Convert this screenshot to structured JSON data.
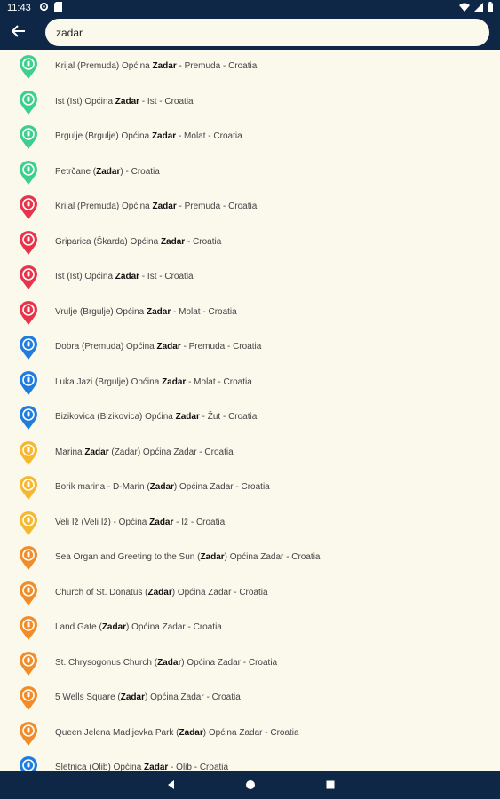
{
  "status_bar": {
    "time": "11:43"
  },
  "search": {
    "value": "zadar"
  },
  "colors": {
    "bar_bg": "#0e2747",
    "page_bg": "#fbf8ec",
    "green": "#3ecf8e",
    "red": "#e8344a",
    "blue": "#1f7de0",
    "yellow": "#f5b82e",
    "orange": "#f28c28"
  },
  "results": [
    {
      "icon": "green-location-pin-icon",
      "color": "green",
      "parts": [
        [
          "Krijal (Premuda) Općina ",
          0
        ],
        [
          "Zadar",
          1
        ],
        [
          " - Premuda - Croatia",
          0
        ]
      ]
    },
    {
      "icon": "green-location-pin-icon",
      "color": "green",
      "parts": [
        [
          "Ist (Ist) Općina ",
          0
        ],
        [
          "Zadar",
          1
        ],
        [
          " - Ist - Croatia",
          0
        ]
      ]
    },
    {
      "icon": "green-location-pin-icon",
      "color": "green",
      "parts": [
        [
          "Brgulje (Brgulje) Općina ",
          0
        ],
        [
          "Zadar",
          1
        ],
        [
          " - Molat - Croatia",
          0
        ]
      ]
    },
    {
      "icon": "green-location-pin-icon",
      "color": "green",
      "parts": [
        [
          "Petrčane (",
          0
        ],
        [
          "Zadar",
          1
        ],
        [
          ") - Croatia",
          0
        ]
      ]
    },
    {
      "icon": "red-location-pin-icon",
      "color": "red",
      "parts": [
        [
          "Krijal (Premuda) Općina ",
          0
        ],
        [
          "Zadar",
          1
        ],
        [
          " - Premuda - Croatia",
          0
        ]
      ]
    },
    {
      "icon": "red-location-pin-icon",
      "color": "red",
      "parts": [
        [
          "Griparica (Škarda) Općina ",
          0
        ],
        [
          "Zadar",
          1
        ],
        [
          " - Croatia",
          0
        ]
      ]
    },
    {
      "icon": "red-location-pin-icon",
      "color": "red",
      "parts": [
        [
          "Ist (Ist) Općina ",
          0
        ],
        [
          "Zadar",
          1
        ],
        [
          " - Ist - Croatia",
          0
        ]
      ]
    },
    {
      "icon": "red-location-pin-icon",
      "color": "red",
      "parts": [
        [
          "Vrulje (Brgulje) Općina ",
          0
        ],
        [
          "Zadar",
          1
        ],
        [
          " - Molat - Croatia",
          0
        ]
      ]
    },
    {
      "icon": "blue-location-pin-icon",
      "color": "blue",
      "parts": [
        [
          "Dobra (Premuda) Općina ",
          0
        ],
        [
          "Zadar",
          1
        ],
        [
          " - Premuda - Croatia",
          0
        ]
      ]
    },
    {
      "icon": "blue-location-pin-icon",
      "color": "blue",
      "parts": [
        [
          "Luka Jazi (Brgulje) Općina ",
          0
        ],
        [
          "Zadar",
          1
        ],
        [
          " - Molat - Croatia",
          0
        ]
      ]
    },
    {
      "icon": "blue-location-pin-icon",
      "color": "blue",
      "parts": [
        [
          "Bizikovica (Bizikovica) Općina ",
          0
        ],
        [
          "Zadar",
          1
        ],
        [
          " - Žut - Croatia",
          0
        ]
      ]
    },
    {
      "icon": "yellow-location-pin-icon",
      "color": "yellow",
      "parts": [
        [
          "Marina ",
          0
        ],
        [
          "Zadar",
          1
        ],
        [
          " (Zadar) Općina Zadar - Croatia",
          0
        ]
      ]
    },
    {
      "icon": "yellow-location-pin-icon",
      "color": "yellow",
      "parts": [
        [
          "Borik marina - D-Marin (",
          0
        ],
        [
          "Zadar",
          1
        ],
        [
          ") Općina Zadar - Croatia",
          0
        ]
      ]
    },
    {
      "icon": "yellow-location-pin-icon",
      "color": "yellow",
      "parts": [
        [
          "Veli Iž (Veli Iž) - Općina ",
          0
        ],
        [
          "Zadar",
          1
        ],
        [
          " - Iž - Croatia",
          0
        ]
      ]
    },
    {
      "icon": "orange-location-pin-icon",
      "color": "orange",
      "parts": [
        [
          "Sea Organ and Greeting to the Sun (",
          0
        ],
        [
          "Zadar",
          1
        ],
        [
          ") Općina Zadar - Croatia",
          0
        ]
      ]
    },
    {
      "icon": "orange-location-pin-icon",
      "color": "orange",
      "parts": [
        [
          "Church of St. Donatus (",
          0
        ],
        [
          "Zadar",
          1
        ],
        [
          ") Općina Zadar - Croatia",
          0
        ]
      ]
    },
    {
      "icon": "orange-location-pin-icon",
      "color": "orange",
      "parts": [
        [
          "Land Gate (",
          0
        ],
        [
          "Zadar",
          1
        ],
        [
          ") Općina Zadar - Croatia",
          0
        ]
      ]
    },
    {
      "icon": "orange-location-pin-icon",
      "color": "orange",
      "parts": [
        [
          "St. Chrysogonus Church (",
          0
        ],
        [
          "Zadar",
          1
        ],
        [
          ") Općina Zadar - Croatia",
          0
        ]
      ]
    },
    {
      "icon": "orange-location-pin-icon",
      "color": "orange",
      "parts": [
        [
          "5 Wells Square (",
          0
        ],
        [
          "Zadar",
          1
        ],
        [
          ") Općina Zadar - Croatia",
          0
        ]
      ]
    },
    {
      "icon": "orange-location-pin-icon",
      "color": "orange",
      "parts": [
        [
          "Queen Jelena Madijevka Park (",
          0
        ],
        [
          "Zadar",
          1
        ],
        [
          ") Općina Zadar - Croatia",
          0
        ]
      ]
    },
    {
      "icon": "blue-location-pin-icon",
      "color": "blue",
      "parts": [
        [
          "Sletnica (Olib) Općina ",
          0
        ],
        [
          "Zadar",
          1
        ],
        [
          " - Olib - Croatia",
          0
        ]
      ]
    }
  ]
}
